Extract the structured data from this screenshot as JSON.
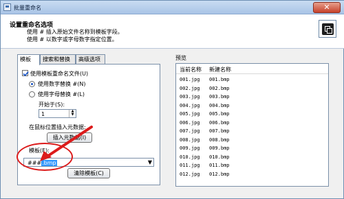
{
  "window": {
    "title": "批量重命名",
    "close_label": "✕"
  },
  "header": {
    "title": "设置重命名选项",
    "line1": "使用 # 插入原始文件名称到模板字段。",
    "line2": "使用 # 以数字或字母数字指定位置。"
  },
  "tabs": [
    {
      "label": "模板"
    },
    {
      "label": "搜索和替换"
    },
    {
      "label": "高级选项"
    }
  ],
  "template_tab": {
    "use_template_label": "使用模板重命名文件(U)",
    "use_template_checked": true,
    "number_replace_label": "使用数字替换 #(N)",
    "letter_replace_label": "使用字母替换 #(L)",
    "start_label": "开始于(S):",
    "start_value": "1",
    "insert_metadata_label": "在鼠标位置插入元数据:",
    "insert_metadata_button": "插入元数据(I)",
    "template_label": "模板(E):",
    "template_prefix": "###",
    "template_selected": ".bmp",
    "clear_template_button": "清除模板(C)"
  },
  "preview": {
    "label": "预览",
    "col_current": "当前名称",
    "col_new": "新建名称",
    "rows": [
      {
        "current": "001.jpg",
        "new": "001.bmp"
      },
      {
        "current": "002.jpg",
        "new": "002.bmp"
      },
      {
        "current": "003.jpg",
        "new": "003.bmp"
      },
      {
        "current": "004.jpg",
        "new": "004.bmp"
      },
      {
        "current": "005.jpg",
        "new": "005.bmp"
      },
      {
        "current": "006.jpg",
        "new": "006.bmp"
      },
      {
        "current": "007.jpg",
        "new": "007.bmp"
      },
      {
        "current": "008.jpg",
        "new": "008.bmp"
      },
      {
        "current": "009.jpg",
        "new": "009.bmp"
      },
      {
        "current": "010.jpg",
        "new": "010.bmp"
      },
      {
        "current": "011.jpg",
        "new": "011.bmp"
      },
      {
        "current": "012.jpg",
        "new": "012.bmp"
      }
    ]
  },
  "colors": {
    "accent": "#1a55c8",
    "annotation": "#dc1b1b"
  }
}
